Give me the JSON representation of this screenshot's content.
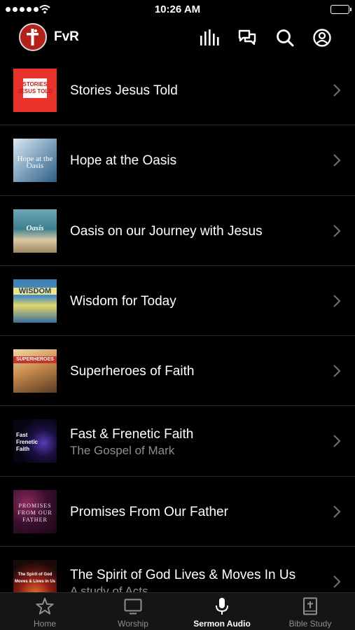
{
  "status_bar": {
    "time": "10:26 AM"
  },
  "app": {
    "title": "FvR"
  },
  "nav_icons": [
    "equalizer-icon",
    "chat-bubbles-icon",
    "search-icon",
    "account-icon"
  ],
  "series": [
    {
      "title": "Stories Jesus Told",
      "subtitle": "",
      "thumb_text": "STORIES JESUS TOLD"
    },
    {
      "title": "Hope at the Oasis",
      "subtitle": "",
      "thumb_text": "Hope at the Oasis"
    },
    {
      "title": "Oasis on our Journey with Jesus",
      "subtitle": "",
      "thumb_text": "Oasis"
    },
    {
      "title": "Wisdom for Today",
      "subtitle": "",
      "thumb_text": "WISDOM"
    },
    {
      "title": "Superheroes of Faith",
      "subtitle": "",
      "thumb_text": "SUPERHEROES"
    },
    {
      "title": "Fast & Frenetic Faith",
      "subtitle": "The Gospel of Mark",
      "thumb_text": "Fast Frenetic Faith"
    },
    {
      "title": "Promises From Our Father",
      "subtitle": "",
      "thumb_text": "PROMISES FROM OUR FATHER"
    },
    {
      "title": "The Spirit of God Lives & Moves In Us",
      "subtitle": "A study of Acts",
      "thumb_text": "The Spirit of God Moves & Lives in Us"
    }
  ],
  "tabs": [
    {
      "label": "Home",
      "icon": "star-icon",
      "active": false
    },
    {
      "label": "Worship",
      "icon": "tv-icon",
      "active": false
    },
    {
      "label": "Sermon Audio",
      "icon": "microphone-icon",
      "active": true
    },
    {
      "label": "Bible Study",
      "icon": "bible-icon",
      "active": false
    }
  ],
  "colors": {
    "background": "#000000",
    "logo": "#b3211b",
    "secondary_text": "#8e8e93",
    "tabbar": "#151515"
  }
}
